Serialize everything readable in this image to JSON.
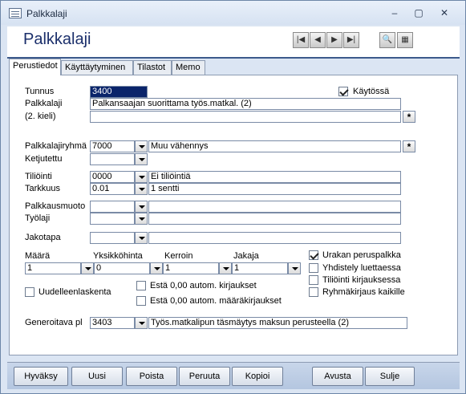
{
  "window": {
    "title": "Palkkalaji",
    "minimize": "–",
    "restore": "▢",
    "close": "✕"
  },
  "header": {
    "title": "Palkkalaji"
  },
  "nav": {
    "first": "|◀",
    "prev": "◀",
    "next": "▶",
    "last": "▶|"
  },
  "tabs": [
    "Perustiedot",
    "Käyttäytyminen",
    "Tilastot",
    "Memo"
  ],
  "form": {
    "tunnus_label": "Tunnus",
    "tunnus": "3400",
    "kaytossa_label": "Käytössä",
    "kaytossa": true,
    "palkkalaji_label": "Palkkalaji",
    "palkkalaji": "Palkansaajan suorittama työs.matkal. (2)",
    "kieli2_label": "(2. kieli)",
    "kieli2": "",
    "ryhma_label": "Palkkalajiryhmä",
    "ryhma_code": "7000",
    "ryhma_name": "Muu vähennys",
    "ketjutettu_label": "Ketjutettu",
    "ketjutettu": "",
    "tiliointi_label": "Tiliöinti",
    "tiliointi_code": "0000",
    "tiliointi_name": "Ei tiliöintiä",
    "tarkkuus_label": "Tarkkuus",
    "tarkkuus_code": "0.01",
    "tarkkuus_name": "1 sentti",
    "palkkausmuoto_label": "Palkkausmuoto",
    "palkkausmuoto": "",
    "tyolaji_label": "Työlaji",
    "tyolaji": "",
    "jakotapa_label": "Jakotapa",
    "jakotapa": "",
    "maara_label": "Määrä",
    "maara": "1",
    "yksikkohinta_label": "Yksikköhinta",
    "yksikkohinta": "0",
    "kerroin_label": "Kerroin",
    "kerroin": "1",
    "jakaja_label": "Jakaja",
    "jakaja": "1",
    "uudelleen_label": "Uudelleenlaskenta",
    "esta1_label": "Estä 0,00 autom. kirjaukset",
    "esta2_label": "Estä 0,00 autom. määräkirjaukset",
    "urakan_label": "Urakan peruspalkka",
    "yhdistely_label": "Yhdistely luettaessa",
    "tiliointikirj_label": "Tiliöinti kirjauksessa",
    "ryhmakirj_label": "Ryhmäkirjaus kaikille",
    "generoitava_label": "Generoitava pl",
    "generoitava_code": "3403",
    "generoitava_name": "Työs.matkalipun täsmäytys maksun perusteella (2)"
  },
  "buttons": [
    "Hyväksy",
    "Uusi",
    "Poista",
    "Peruuta",
    "Kopioi",
    "Avusta",
    "Sulje"
  ]
}
